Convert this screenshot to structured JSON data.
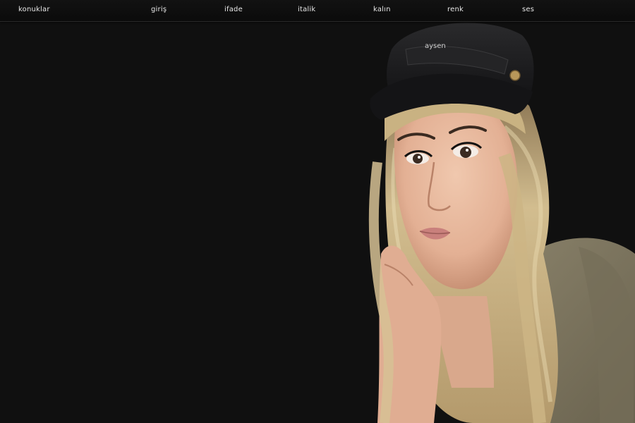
{
  "nav": {
    "items": [
      {
        "id": "konuklar",
        "label": "konuklar"
      },
      {
        "id": "giris",
        "label": "giriş"
      },
      {
        "id": "ifade",
        "label": "ifade"
      },
      {
        "id": "italik",
        "label": "italik"
      },
      {
        "id": "kalin",
        "label": "kalın"
      },
      {
        "id": "renk",
        "label": "renk"
      },
      {
        "id": "ses",
        "label": "ses"
      }
    ]
  },
  "portrait": {
    "cap_text": "aysen"
  },
  "colors": {
    "background": "#101010",
    "nav_text": "#e6e6e6",
    "hair": "#cbb68a",
    "skin": "#e9bca2",
    "shirt": "#7e7660",
    "cap": "#1b1b1d"
  }
}
